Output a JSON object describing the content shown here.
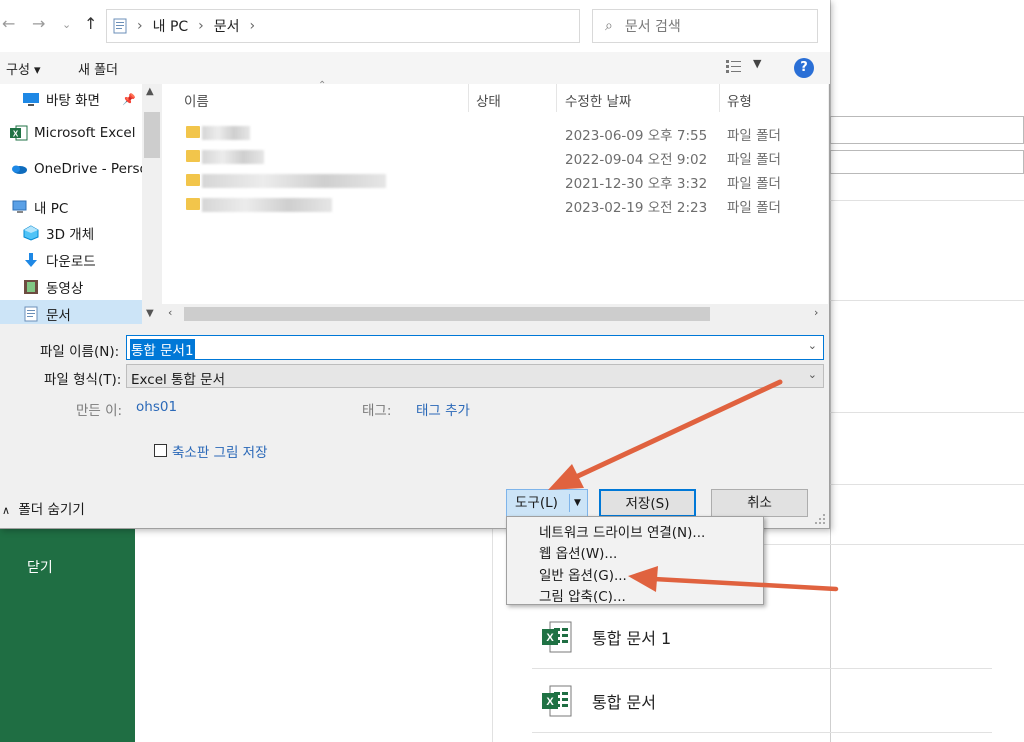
{
  "dialog": {
    "address": {
      "crumbs": [
        "내 PC",
        "문서"
      ],
      "search_placeholder": "문서 검색"
    },
    "toolbar": {
      "organize": "구성 ▾",
      "new_folder": "새 폴더"
    },
    "nav_pane": {
      "items": [
        {
          "label": "바탕 화면",
          "icon": "desktop-icon"
        },
        {
          "label": "Microsoft Excel",
          "icon": "excel-icon"
        },
        {
          "label": "OneDrive - Perso",
          "icon": "onedrive-icon"
        },
        {
          "label": "내 PC",
          "icon": "computer-icon"
        },
        {
          "label": "3D 개체",
          "icon": "3d-objects-icon"
        },
        {
          "label": "다운로드",
          "icon": "download-icon"
        },
        {
          "label": "동영상",
          "icon": "video-icon"
        },
        {
          "label": "문서",
          "icon": "document-icon"
        }
      ]
    },
    "file_list": {
      "columns": [
        "이름",
        "상태",
        "수정한 날짜",
        "유형"
      ],
      "rows": [
        {
          "date": "2023-06-09 오후 7:55",
          "type": "파일 폴더"
        },
        {
          "date": "2022-09-04 오전 9:02",
          "type": "파일 폴더"
        },
        {
          "date": "2021-12-30 오후 3:32",
          "type": "파일 폴더"
        },
        {
          "date": "2023-02-19 오전 2:23",
          "type": "파일 폴더"
        }
      ]
    },
    "form": {
      "file_name_label": "파일 이름(N):",
      "file_name_value": "통합 문서1",
      "file_type_label": "파일 형식(T):",
      "file_type_value": "Excel 통합 문서",
      "author_label": "만든 이:",
      "author_value": "ohs01",
      "tags_label": "태그:",
      "tags_value": "태그 추가",
      "thumbnail_label": "축소판 그림 저장",
      "hide_folders": "폴더 숨기기"
    },
    "buttons": {
      "tools": "도구(L)",
      "save": "저장(S)",
      "cancel": "취소"
    },
    "tools_menu": [
      "네트워크 드라이브 연결(N)...",
      "웹 옵션(W)...",
      "일반 옵션(G)...",
      "그림 압축(C)..."
    ]
  },
  "backstage": {
    "close_label": "닫기",
    "recent_files": [
      "통합 문서 1",
      "통합 문서"
    ]
  },
  "colors": {
    "accent": "#0078d7",
    "excel_green": "#1f6e43",
    "annotation_arrow": "#e0623f"
  }
}
